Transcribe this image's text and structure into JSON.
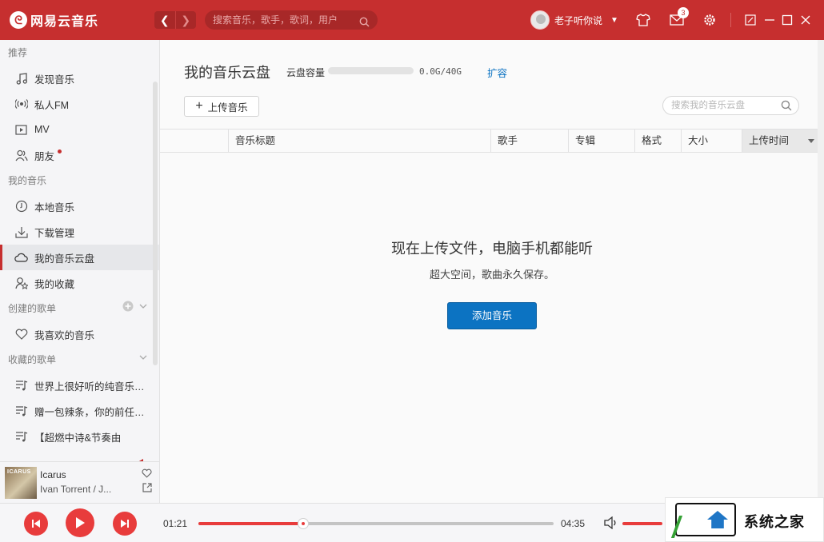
{
  "app": {
    "name": "网易云音乐"
  },
  "header": {
    "search_placeholder": "搜索音乐，歌手，歌词，用户",
    "username": "老子听你说",
    "mail_badge": "3",
    "back_glyph": "❮",
    "forward_glyph": "❯"
  },
  "sidebar": {
    "sections": [
      {
        "title": "推荐",
        "items": [
          {
            "label": "发现音乐",
            "icon": "music-note-icon"
          },
          {
            "label": "私人FM",
            "icon": "radio-icon"
          },
          {
            "label": "MV",
            "icon": "video-icon"
          },
          {
            "label": "朋友",
            "icon": "friends-icon",
            "dot": true
          }
        ]
      },
      {
        "title": "我的音乐",
        "items": [
          {
            "label": "本地音乐",
            "icon": "disc-icon"
          },
          {
            "label": "下载管理",
            "icon": "download-icon"
          },
          {
            "label": "我的音乐云盘",
            "icon": "cloud-icon",
            "active": true
          },
          {
            "label": "我的收藏",
            "icon": "collection-icon"
          }
        ]
      },
      {
        "title": "创建的歌单",
        "items": [
          {
            "label": "我喜欢的音乐",
            "icon": "heart-icon"
          }
        ]
      },
      {
        "title": "收藏的歌单",
        "items": [
          {
            "label": "世界上很好听的纯音乐（…",
            "icon": "playlist-icon"
          },
          {
            "label": "赠一包辣条，你的前任听…",
            "icon": "playlist-icon"
          },
          {
            "label": "【超燃中诗&节奏由",
            "icon": "playlist-icon"
          }
        ]
      }
    ]
  },
  "now_playing": {
    "title": "Icarus",
    "artist": "Ivan Torrent / J...",
    "cover_text": "ICARUS"
  },
  "cloud": {
    "title": "我的音乐云盘",
    "capacity_label": "云盘容量",
    "capacity_value": "0.0G/40G",
    "capacity_used_fraction": 0.0,
    "expand_label": "扩容",
    "upload_label": "上传音乐",
    "search_placeholder": "搜索我的音乐云盘",
    "columns": [
      "音乐标题",
      "歌手",
      "专辑",
      "格式",
      "大小",
      "上传时间"
    ],
    "empty_title": "现在上传文件，电脑手机都能听",
    "empty_subtitle": "超大空间，歌曲永久保存。",
    "add_button": "添加音乐"
  },
  "player": {
    "elapsed": "01:21",
    "duration": "04:35",
    "progress_fraction": 0.294,
    "volume_fraction": 1.0
  },
  "watermark": {
    "text": "系统之家"
  },
  "colors": {
    "brand": "#c62f2f",
    "accent_blue": "#0c73c2",
    "play_red": "#e83c3c"
  }
}
